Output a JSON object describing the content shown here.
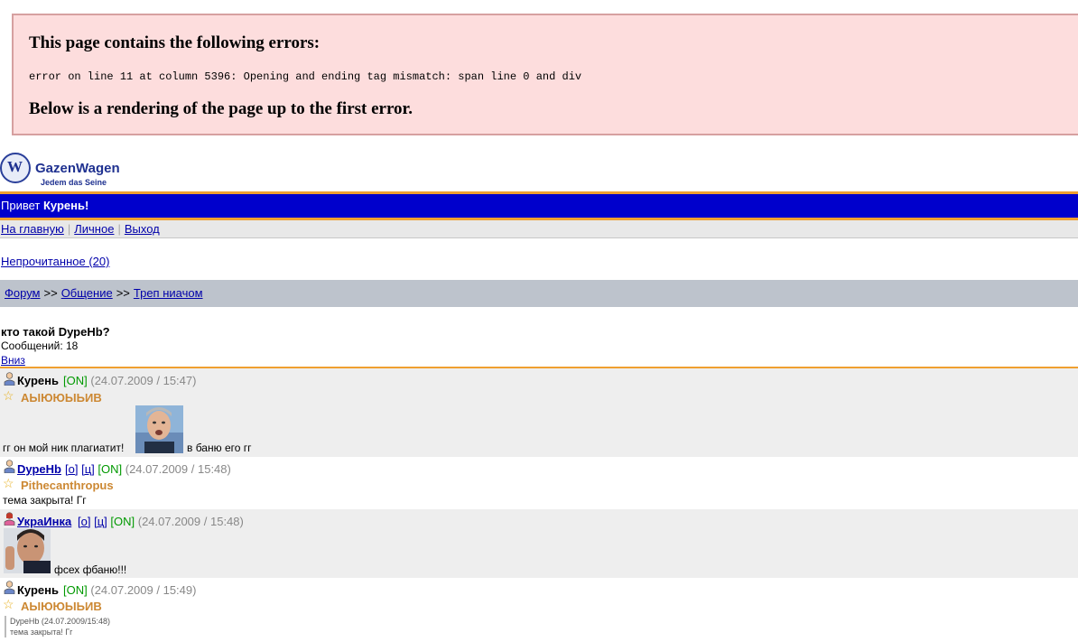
{
  "error": {
    "heading": "This page contains the following errors:",
    "message": "error on line 11 at column 5396: Opening and ending tag mismatch: span line 0 and div",
    "footer": "Below is a rendering of the page up to the first error."
  },
  "logo": {
    "title": "GazenWagen",
    "subtitle": "Jedem das Seine",
    "mark": "W"
  },
  "greeting": {
    "prefix": "Привет",
    "user": "Курень!"
  },
  "nav": {
    "home": "На главную",
    "personal": "Личное",
    "logout": "Выход"
  },
  "unread": "Непрочитанное (20)",
  "breadcrumbs": {
    "forum": "Форум",
    "sep": ">>",
    "general": "Общение",
    "section": "Треп ниачом"
  },
  "topic": {
    "title": "кто такой DуреНb?",
    "count": "Сообщений: 18",
    "down": "Вниз"
  },
  "posts": [
    {
      "author": "Курень",
      "status": "[ON]",
      "date": "(24.07.2009 / 15:47)",
      "rank": "АЫЮЮЫЬИВ",
      "text_before": "гг он мой ник плагиатит!",
      "text_after": "в баню его гг"
    },
    {
      "author": "DуреНb",
      "o": "[о]",
      "c": "[ц]",
      "status": "[ON]",
      "date": "(24.07.2009 / 15:48)",
      "rank": "Pithecanthropus",
      "text": "тема закрыта! Гг"
    },
    {
      "author": "УкраИнка",
      "o": "[о]",
      "c": "[ц]",
      "status": "[ON]",
      "date": "(24.07.2009 / 15:48)",
      "text": "фсех фбаню!!!"
    },
    {
      "author": "Курень",
      "status": "[ON]",
      "date": "(24.07.2009 / 15:49)",
      "rank": "АЫЮЮЫЬИВ",
      "quote_head": "DуреНb (24.07.2009/15:48)",
      "quote_text": "тема закрыта! Гг"
    }
  ]
}
